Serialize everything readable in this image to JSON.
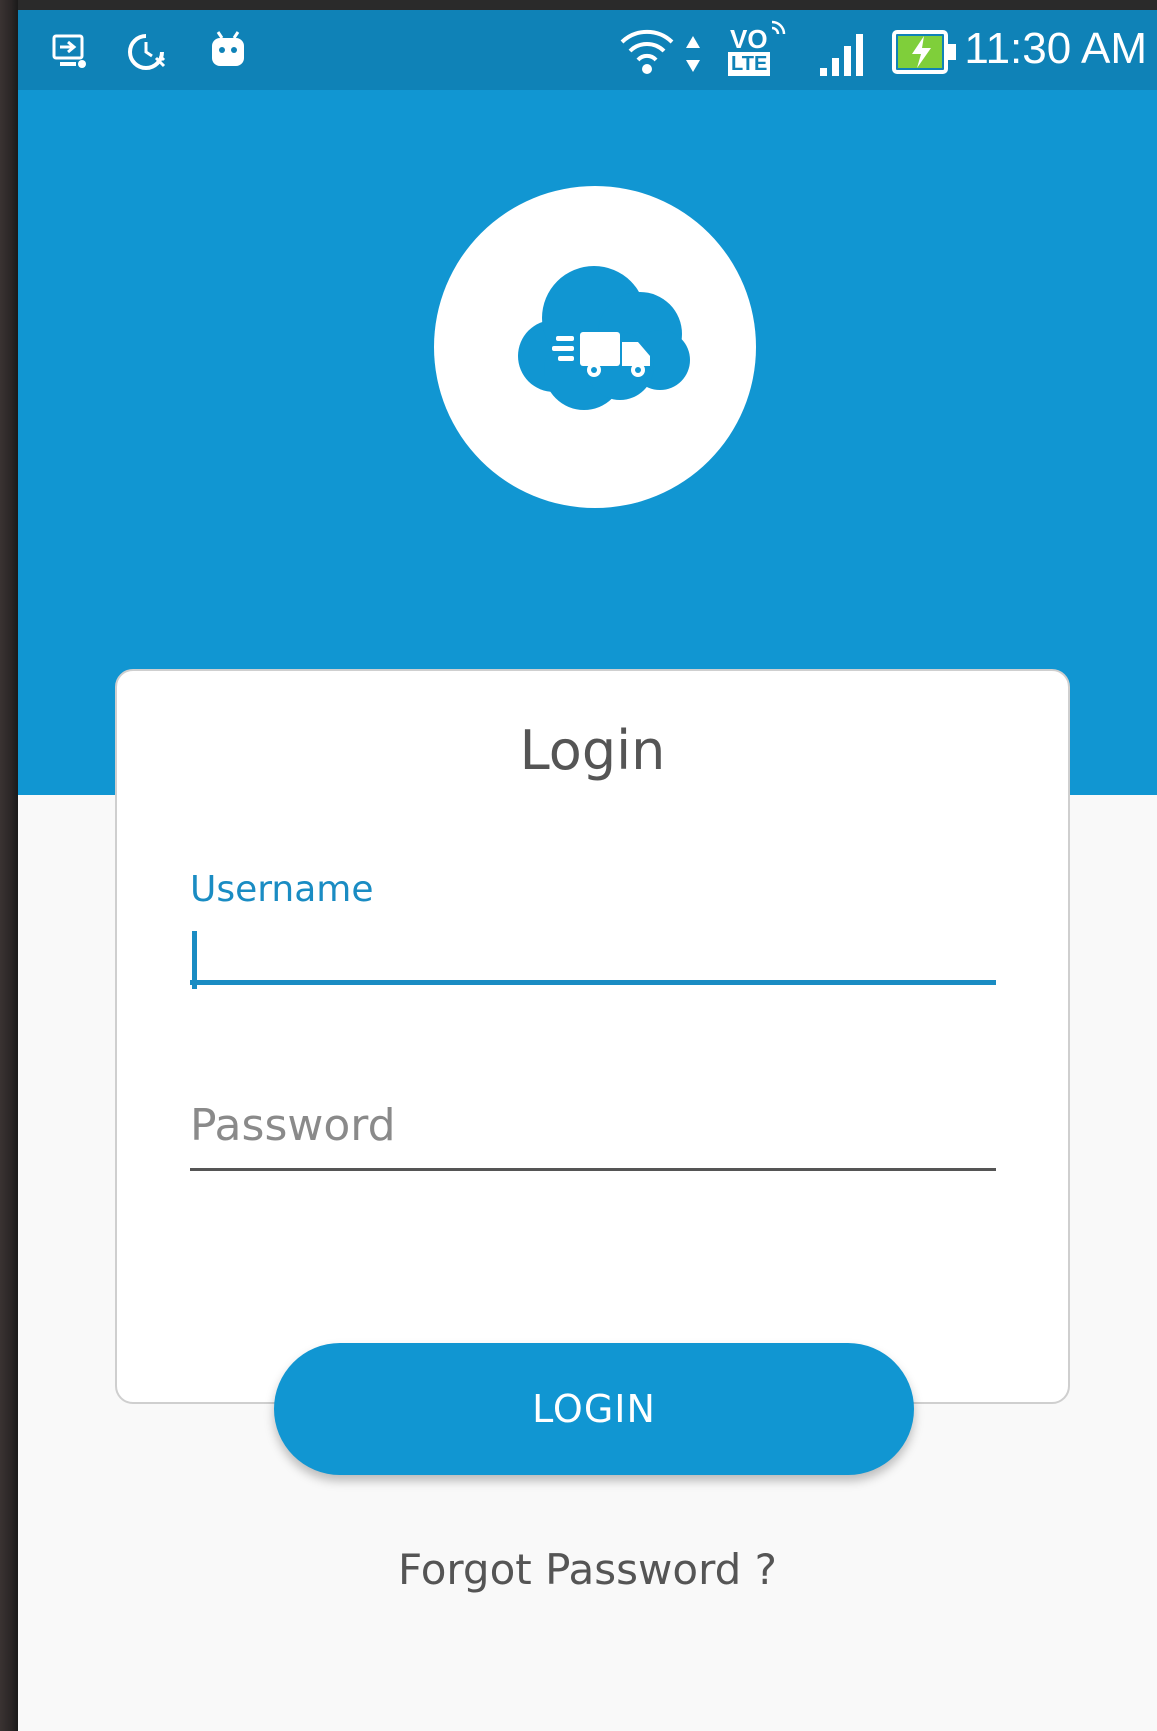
{
  "status_bar": {
    "time": "11:30 AM",
    "volte_badge_top": "VO",
    "volte_badge_bottom": "LTE",
    "icons": [
      "screen-cast-icon",
      "data-saver-icon",
      "android-icon",
      "wifi-icon",
      "data-arrows-icon",
      "volte-icon",
      "signal-icon",
      "battery-charging-icon"
    ]
  },
  "logo": {
    "icon": "cloud-delivery-truck-icon",
    "accent_color": "#1196d2"
  },
  "login_card": {
    "title": "Login",
    "username_label": "Username",
    "username_value": "",
    "password_placeholder": "Password"
  },
  "login_button": {
    "label": "LOGIN"
  },
  "forgot_password": {
    "label": "Forgot Password ?"
  },
  "colors": {
    "primary": "#1196d2",
    "status_bar": "#0f82b7",
    "background": "#f9f9f9",
    "text_secondary": "#555555"
  }
}
